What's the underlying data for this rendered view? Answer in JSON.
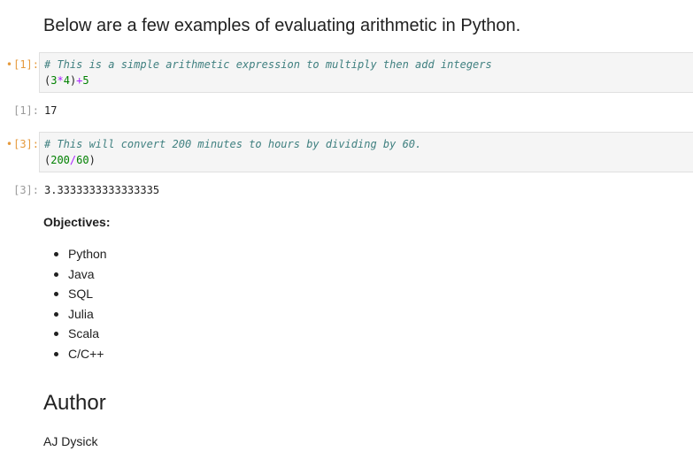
{
  "intro": {
    "heading": "Below are a few examples of evaluating arithmetic in Python."
  },
  "cells": [
    {
      "in_prompt": "[1]:",
      "comment": "# This is a simple arithmetic expression to multiply then add integers",
      "code_tokens": {
        "open_paren": "(",
        "n1": "3",
        "op1": "*",
        "n2": "4",
        "close_paren": ")",
        "op2": "+",
        "n3": "5"
      },
      "out_prompt": "[1]:",
      "output": "17"
    },
    {
      "in_prompt": "[3]:",
      "comment": "# This will convert 200 minutes to hours by dividing by 60.",
      "code_tokens": {
        "open_paren": "(",
        "n1": "200",
        "op1": "/",
        "n2": "60",
        "close_paren": ")"
      },
      "out_prompt": "[3]:",
      "output": "3.3333333333333335"
    }
  ],
  "objectives": {
    "title": "Objectives:",
    "items": [
      "Python",
      "Java",
      "SQL",
      "Julia",
      "Scala",
      "C/C++"
    ]
  },
  "author": {
    "heading": "Author",
    "name": "AJ Dysick"
  },
  "colors": {
    "prompt_in": "#e59a3d",
    "prompt_out": "#9a9a9a",
    "comment": "#408080",
    "number": "#008000",
    "operator": "#aa22ff",
    "code_bg": "#f5f5f5"
  }
}
